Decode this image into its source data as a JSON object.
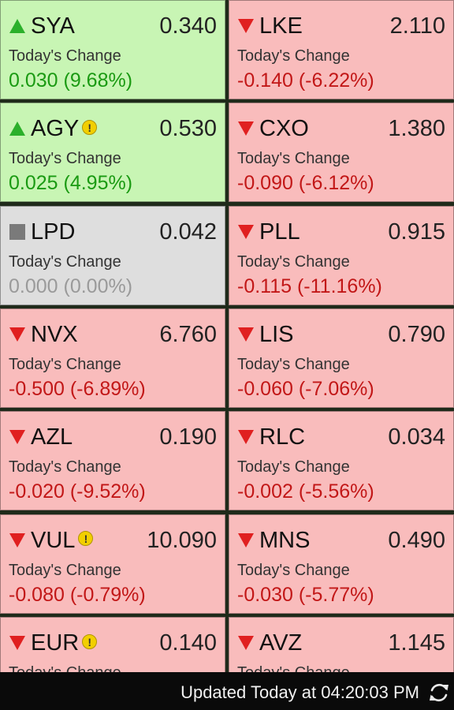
{
  "colors": {
    "up_bg": "#c8f5b4",
    "down_bg": "#f9bcbc",
    "flat_bg": "#dedede",
    "up_text": "#1a9a12",
    "down_text": "#c21717",
    "flat_text": "#9a9a9a",
    "up_arrow": "#2bb02b",
    "down_arrow": "#e02020",
    "flat_marker": "#7a7a7a",
    "warning": "#f2cf00"
  },
  "tiles": [
    {
      "code": "SYA",
      "price": "0.340",
      "change_label": "Today's Change",
      "change": "0.030 (9.68%)",
      "trend": "up",
      "warning": false
    },
    {
      "code": "LKE",
      "price": "2.110",
      "change_label": "Today's Change",
      "change": "-0.140 (-6.22%)",
      "trend": "down",
      "warning": false
    },
    {
      "code": "AGY",
      "price": "0.530",
      "change_label": "Today's Change",
      "change": "0.025 (4.95%)",
      "trend": "up",
      "warning": true
    },
    {
      "code": "CXO",
      "price": "1.380",
      "change_label": "Today's Change",
      "change": "-0.090 (-6.12%)",
      "trend": "down",
      "warning": false
    },
    {
      "code": "LPD",
      "price": "0.042",
      "change_label": "Today's Change",
      "change": "0.000 (0.00%)",
      "trend": "flat",
      "warning": false
    },
    {
      "code": "PLL",
      "price": "0.915",
      "change_label": "Today's Change",
      "change": "-0.115 (-11.16%)",
      "trend": "down",
      "warning": false
    },
    {
      "code": "NVX",
      "price": "6.760",
      "change_label": "Today's Change",
      "change": "-0.500 (-6.89%)",
      "trend": "down",
      "warning": false
    },
    {
      "code": "LIS",
      "price": "0.790",
      "change_label": "Today's Change",
      "change": "-0.060 (-7.06%)",
      "trend": "down",
      "warning": false
    },
    {
      "code": "AZL",
      "price": "0.190",
      "change_label": "Today's Change",
      "change": "-0.020 (-9.52%)",
      "trend": "down",
      "warning": false
    },
    {
      "code": "RLC",
      "price": "0.034",
      "change_label": "Today's Change",
      "change": "-0.002 (-5.56%)",
      "trend": "down",
      "warning": false
    },
    {
      "code": "VUL",
      "price": "10.090",
      "change_label": "Today's Change",
      "change": "-0.080 (-0.79%)",
      "trend": "down",
      "warning": true
    },
    {
      "code": "MNS",
      "price": "0.490",
      "change_label": "Today's Change",
      "change": "-0.030 (-5.77%)",
      "trend": "down",
      "warning": false
    },
    {
      "code": "EUR",
      "price": "0.140",
      "change_label": "Today's Change",
      "change": "",
      "trend": "down",
      "warning": true
    },
    {
      "code": "AVZ",
      "price": "1.145",
      "change_label": "Today's Change",
      "change": "",
      "trend": "down",
      "warning": false
    }
  ],
  "warning_glyph": "!",
  "status_bar": {
    "text": "Updated Today at 04:20:03 PM",
    "refresh_icon": "refresh-icon"
  }
}
